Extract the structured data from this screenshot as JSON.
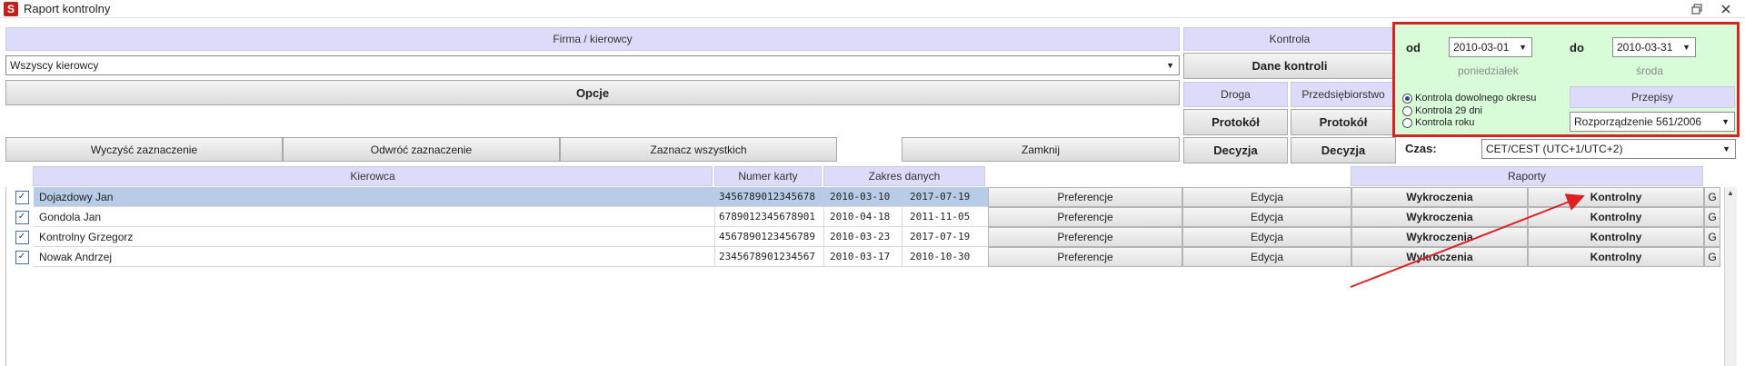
{
  "window": {
    "app_icon": "app-logo-icon",
    "title": "Raport kontrolny",
    "controls": [
      "restore-icon",
      "close-icon"
    ]
  },
  "firma_panel": {
    "header": "Firma / kierowcy",
    "driver_select": "Wszyscy kierowcy",
    "options_button": "Opcje",
    "clear_selection": "Wyczyść zaznaczenie",
    "invert_selection": "Odwróć zaznaczenie",
    "select_all": "Zaznacz wszystkich",
    "close_button": "Zamknij"
  },
  "kontrola_panel": {
    "header": "Kontrola",
    "control_data_button": "Dane kontroli",
    "droga_header": "Droga",
    "przedsiebiorstwo_header": "Przedsiębiorstwo",
    "protokol_droga": "Protokół",
    "protokol_przeds": "Protokół",
    "decyzja_droga": "Decyzja",
    "decyzja_przeds": "Decyzja"
  },
  "period_panel": {
    "from_label": "od",
    "from_date": "2010-03-01",
    "from_day": "poniedziałek",
    "to_label": "do",
    "to_date": "2010-03-31",
    "to_day": "środa",
    "radios": [
      {
        "label": "Kontrola dowolnego okresu",
        "checked": true
      },
      {
        "label": "Kontrola 29 dni",
        "checked": false
      },
      {
        "label": "Kontrola roku",
        "checked": false
      }
    ],
    "przepisy_header": "Przepisy",
    "przepisy_select": "Rozporządzenie 561/2006",
    "czas_label": "Czas:",
    "czas_select": "CET/CEST (UTC+1/UTC+2)"
  },
  "table": {
    "columns": {
      "kierowca": "Kierowca",
      "numer_karty": "Numer karty",
      "zakres": "Zakres danych",
      "raporty": "Raporty"
    },
    "rows": [
      {
        "checked": true,
        "name": "Dojazdowy Jan",
        "card": "3456789012345678",
        "from": "2010-03-10",
        "to": "2017-07-19",
        "pref": "Preferencje",
        "edit": "Edycja",
        "wykr": "Wykroczenia",
        "kontr": "Kontrolny",
        "g": "G",
        "selected": true
      },
      {
        "checked": true,
        "name": "Gondola Jan",
        "card": "6789012345678901",
        "from": "2010-04-18",
        "to": "2011-11-05",
        "pref": "Preferencje",
        "edit": "Edycja",
        "wykr": "Wykroczenia",
        "kontr": "Kontrolny",
        "g": "G",
        "selected": false
      },
      {
        "checked": true,
        "name": "Kontrolny Grzegorz",
        "card": "4567890123456789",
        "from": "2010-03-23",
        "to": "2017-07-19",
        "pref": "Preferencje",
        "edit": "Edycja",
        "wykr": "Wykroczenia",
        "kontr": "Kontrolny",
        "g": "G",
        "selected": false
      },
      {
        "checked": true,
        "name": "Nowak Andrzej",
        "card": "2345678901234567",
        "from": "2010-03-17",
        "to": "2010-10-30",
        "pref": "Preferencje",
        "edit": "Edycja",
        "wykr": "Wykroczenia",
        "kontr": "Kontrolny",
        "g": "G",
        "selected": false
      }
    ]
  },
  "colors": {
    "highlight_border": "#dd2020",
    "period_bg": "#d8fbd8",
    "header_bg": "#dcdcfa",
    "selected_row": "#b8cce8",
    "arrow": "#dd2020"
  }
}
